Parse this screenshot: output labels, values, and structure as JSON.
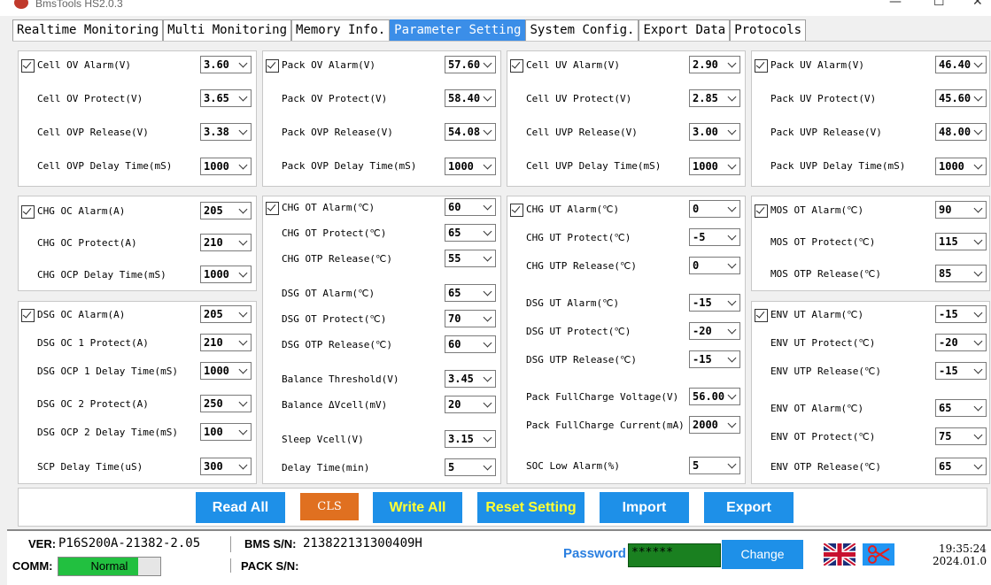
{
  "window": {
    "title": "BmsTools HS2.0.3"
  },
  "tabs": [
    "Realtime Monitoring",
    "Multi Monitoring",
    "Memory Info.",
    "Parameter Setting",
    "System Config.",
    "Export Data",
    "Protocols"
  ],
  "p1": [
    {
      "label": "Cell OV Alarm(V)",
      "value": "3.60",
      "checked": true
    },
    {
      "label": "Cell OV Protect(V)",
      "value": "3.65"
    },
    {
      "label": "Cell OVP Release(V)",
      "value": "3.38"
    },
    {
      "label": "Cell OVP Delay Time(mS)",
      "value": "1000"
    }
  ],
  "p2": [
    {
      "label": "Pack OV Alarm(V)",
      "value": "57.60",
      "checked": true
    },
    {
      "label": "Pack OV Protect(V)",
      "value": "58.40"
    },
    {
      "label": "Pack OVP Release(V)",
      "value": "54.08"
    },
    {
      "label": "Pack OVP Delay Time(mS)",
      "value": "1000"
    }
  ],
  "p3": [
    {
      "label": "Cell UV Alarm(V)",
      "value": "2.90",
      "checked": true
    },
    {
      "label": "Cell UV Protect(V)",
      "value": "2.85"
    },
    {
      "label": "Cell UVP Release(V)",
      "value": "3.00"
    },
    {
      "label": "Cell UVP Delay Time(mS)",
      "value": "1000"
    }
  ],
  "p4": [
    {
      "label": "Pack UV Alarm(V)",
      "value": "46.40",
      "checked": true
    },
    {
      "label": "Pack UV Protect(V)",
      "value": "45.60"
    },
    {
      "label": "Pack UVP Release(V)",
      "value": "48.00"
    },
    {
      "label": "Pack UVP Delay Time(mS)",
      "value": "1000"
    }
  ],
  "p5": [
    {
      "label": "CHG OC Alarm(A)",
      "value": "205",
      "checked": true
    },
    {
      "label": "CHG OC Protect(A)",
      "value": "210"
    },
    {
      "label": "CHG OCP Delay Time(mS)",
      "value": "1000"
    }
  ],
  "p6": [
    {
      "label": "DSG OC Alarm(A)",
      "value": "205",
      "checked": true
    },
    {
      "label": "DSG OC 1 Protect(A)",
      "value": "210"
    },
    {
      "label": "DSG OCP 1 Delay Time(mS)",
      "value": "1000"
    },
    {
      "label": "DSG OC 2 Protect(A)",
      "value": "250"
    },
    {
      "label": "DSG OCP 2 Delay Time(mS)",
      "value": "100"
    },
    {
      "label": "SCP Delay Time(uS)",
      "value": "300"
    }
  ],
  "p7": [
    {
      "label": "CHG OT Alarm(℃)",
      "value": "60",
      "checked": true
    },
    {
      "label": "CHG OT Protect(℃)",
      "value": "65"
    },
    {
      "label": "CHG OTP Release(℃)",
      "value": "55"
    },
    {
      "label": "DSG OT Alarm(℃)",
      "value": "65"
    },
    {
      "label": "DSG OT Protect(℃)",
      "value": "70"
    },
    {
      "label": "DSG OTP Release(℃)",
      "value": "60"
    },
    {
      "label": "Balance Threshold(V)",
      "value": "3.45"
    },
    {
      "label": "Balance ΔVcell(mV)",
      "value": "20"
    },
    {
      "label": "Sleep Vcell(V)",
      "value": "3.15"
    },
    {
      "label": "Delay Time(min)",
      "value": "5"
    }
  ],
  "p8": [
    {
      "label": "CHG UT Alarm(℃)",
      "value": "0",
      "checked": true
    },
    {
      "label": "CHG UT Protect(℃)",
      "value": "-5"
    },
    {
      "label": "CHG UTP Release(℃)",
      "value": "0"
    },
    {
      "label": "DSG UT Alarm(℃)",
      "value": "-15"
    },
    {
      "label": "DSG UT Protect(℃)",
      "value": "-20"
    },
    {
      "label": "DSG UTP Release(℃)",
      "value": "-15"
    },
    {
      "label": "Pack FullCharge Voltage(V)",
      "value": "56.00"
    },
    {
      "label": "Pack FullCharge Current(mA)",
      "value": "2000"
    },
    {
      "label": "SOC Low Alarm(%)",
      "value": "5"
    }
  ],
  "p9": [
    {
      "label": "MOS OT Alarm(℃)",
      "value": "90",
      "checked": true
    },
    {
      "label": "MOS OT Protect(℃)",
      "value": "115"
    },
    {
      "label": "MOS OTP Release(℃)",
      "value": "85"
    }
  ],
  "p10": [
    {
      "label": "ENV UT Alarm(℃)",
      "value": "-15",
      "checked": true
    },
    {
      "label": "ENV UT Protect(℃)",
      "value": "-20"
    },
    {
      "label": "ENV UTP Release(℃)",
      "value": "-15"
    },
    {
      "label": "ENV OT Alarm(℃)",
      "value": "65"
    },
    {
      "label": "ENV OT Protect(℃)",
      "value": "75"
    },
    {
      "label": "ENV OTP Release(℃)",
      "value": "65"
    }
  ],
  "buttons": {
    "read_all": "Read All",
    "cls": "CLS",
    "write_all": "Write All",
    "reset_setting": "Reset Setting",
    "import": "Import",
    "export": "Export"
  },
  "status": {
    "ver_label": "VER:",
    "ver_value": "P16S200A-21382-2.05",
    "comm_label": "COMM:",
    "comm_value": "Normal",
    "bms_sn_label": "BMS S/N:",
    "bms_sn_value": "213822131300409H",
    "pack_sn_label": "PACK S/N:",
    "password_label": "Password",
    "password_value": "******",
    "change_label": "Change",
    "time": "19:35:24",
    "date": "2024.01.0"
  },
  "colors": {
    "accent": "#1e90e8",
    "cls": "#e07020",
    "comm_ok": "#22c040"
  }
}
